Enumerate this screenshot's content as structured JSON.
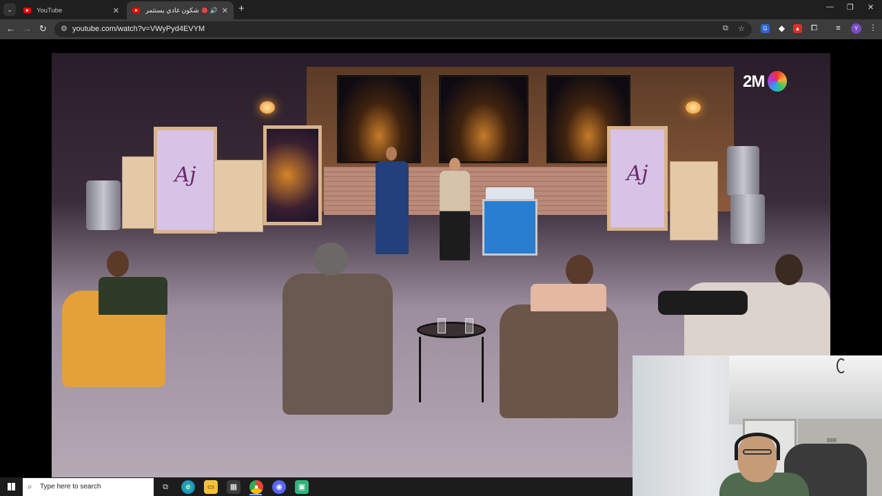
{
  "browser": {
    "tabs": [
      {
        "title": "YouTube",
        "active": false
      },
      {
        "title": "شكون غادي يستثمر فمنـ...",
        "active": true
      }
    ],
    "url": "youtube.com/watch?v=VWyPyd4EVYM",
    "profile_initial": "Y",
    "new_tab_glyph": "+",
    "window_controls": [
      "—",
      "❐",
      "✕"
    ]
  },
  "video": {
    "channel_logo": "2M",
    "panel_logo": "Aj"
  },
  "taskbar": {
    "search_placeholder": "Type here to search",
    "apps": [
      "task-view",
      "edge",
      "file-explorer",
      "microsoft-store",
      "chrome",
      "discord",
      "app"
    ]
  },
  "colors": {
    "tabstrip_bg": "#1f1f1f",
    "toolbar_bg": "#3c3c3c",
    "omnibox_bg": "#282828",
    "taskbar_bg": "#1c1c1c",
    "youtube_red": "#ff0000"
  }
}
